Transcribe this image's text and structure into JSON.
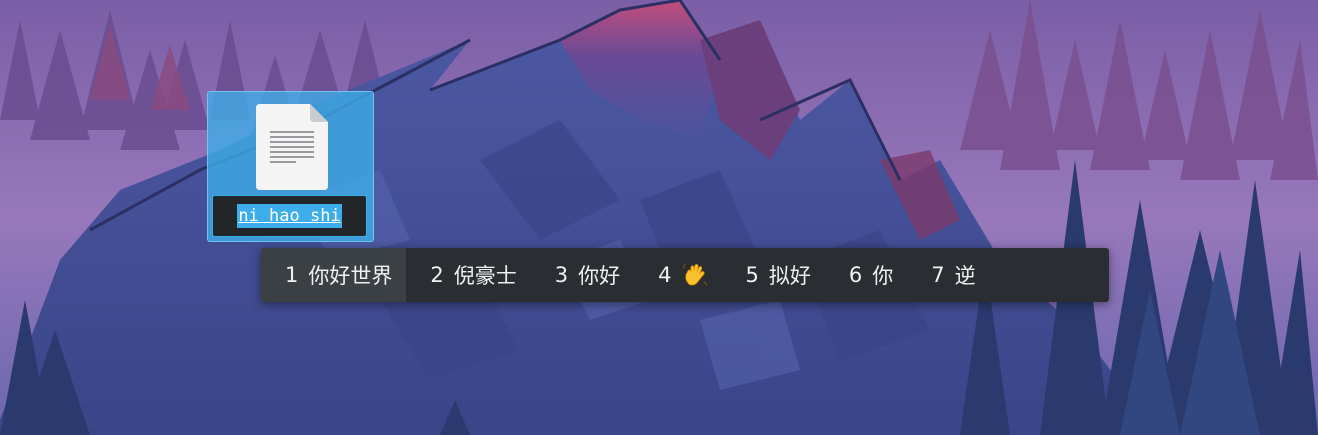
{
  "desktop_icon": {
    "icon_name": "text-file-icon",
    "rename_value": "ni hao shi",
    "selection_color": "#3daee9"
  },
  "ime": {
    "candidates": [
      {
        "num": "1",
        "text": "你好世界",
        "highlighted": true
      },
      {
        "num": "2",
        "text": "倪豪士",
        "highlighted": false
      },
      {
        "num": "3",
        "text": "你好",
        "highlighted": false
      },
      {
        "num": "4",
        "text": "",
        "emoji": "waving-hand-icon",
        "highlighted": false
      },
      {
        "num": "5",
        "text": "拟好",
        "highlighted": false
      },
      {
        "num": "6",
        "text": "你",
        "highlighted": false
      },
      {
        "num": "7",
        "text": "逆",
        "highlighted": false
      }
    ],
    "background_color": "#2a2e32",
    "highlight_color": "#3b4045"
  }
}
